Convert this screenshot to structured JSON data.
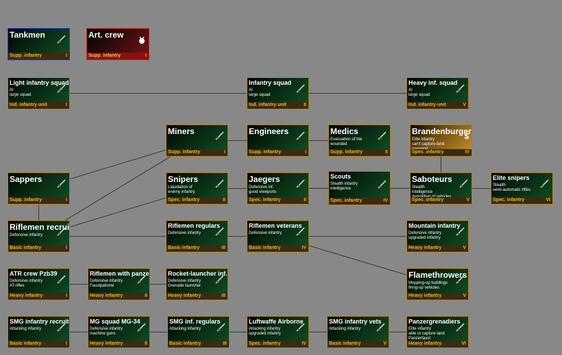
{
  "nodes": [
    {
      "id": "tankmen",
      "name": "Tankmen",
      "desc": "",
      "cls": "Supp. infantry",
      "tier": "I",
      "style": "blue",
      "big": true,
      "icon": "rifle-icon"
    },
    {
      "id": "artcrew",
      "name": "Art. crew",
      "desc": "",
      "cls": "Supp. infantry",
      "tier": "I",
      "style": "red",
      "big": true,
      "icon": "medal-icon"
    },
    {
      "id": "light_inf",
      "name": "Light infantry squad",
      "desc": "AI\nlarge squad",
      "cls": "Ind. infantry unit",
      "tier": "I",
      "big": false,
      "icon": "rifle-icon"
    },
    {
      "id": "inf_squad",
      "name": "Infantry squad",
      "desc": "AI\nlarge squad",
      "cls": "Ind. infantry unit",
      "tier": "II",
      "big": false,
      "icon": "rifle-icon"
    },
    {
      "id": "heavy_squad",
      "name": "Heavy inf. squad",
      "desc": "AI\nlarge squad",
      "cls": "Ind. infantry unit",
      "tier": "V",
      "big": false,
      "icon": "rifle-icon"
    },
    {
      "id": "miners",
      "name": "Miners",
      "desc": "",
      "cls": "Supp. infantry",
      "tier": "I",
      "big": true,
      "icon": "rifle-icon"
    },
    {
      "id": "engineers",
      "name": "Engineers",
      "desc": "",
      "cls": "Supp. infantry",
      "tier": "I",
      "big": true,
      "icon": "rifle-icon"
    },
    {
      "id": "medics",
      "name": "Medics",
      "desc": "Evacuation of the\nwounded",
      "cls": "Supp. infantry",
      "tier": "II",
      "big": true,
      "icon": "rifle-icon"
    },
    {
      "id": "brandenburgers",
      "name": "Brandenburgers",
      "desc": "Elite infantry\ncan't capture land\ntransport",
      "cls": "Spec. infantry",
      "tier": "IV",
      "style": "gold",
      "big": true,
      "icon": "dollar-icon"
    },
    {
      "id": "sappers",
      "name": "Sappers",
      "desc": "",
      "cls": "Supp. infantry",
      "tier": "I",
      "big": true,
      "icon": "rifle-icon"
    },
    {
      "id": "snipers",
      "name": "Snipers",
      "desc": "Liquidation of\nenemy infantry",
      "cls": "Spec. infantry",
      "tier": "II",
      "big": true,
      "icon": "rifle-icon"
    },
    {
      "id": "jaegers",
      "name": "Jaegers",
      "desc": "Defensive inf.\ngood viewports",
      "cls": "Spec. infantry",
      "tier": "II",
      "big": true,
      "icon": "rifle-icon"
    },
    {
      "id": "scouts",
      "name": "Scouts",
      "desc": "Stealth infantry\nintelligence",
      "cls": "Spec. infantry",
      "tier": "IV",
      "big": false,
      "icon": "rifle-icon"
    },
    {
      "id": "saboteurs",
      "name": "Saboteurs",
      "desc": "Stealth\nintelligence\ndemolition of vehicles",
      "cls": "Spec. infantry",
      "tier": "V",
      "big": true,
      "icon": "rifle-icon"
    },
    {
      "id": "elite_snipers",
      "name": "Elite snipers",
      "desc": "Stealth\nsemi-automatic rifles",
      "cls": "Spec. infantry",
      "tier": "VI",
      "big": false,
      "icon": "rifle-icon"
    },
    {
      "id": "rifle_recruits",
      "name": "Riflemen recruits",
      "desc": "Defensive infantry",
      "cls": "Basic infantry",
      "tier": "I",
      "big": true,
      "icon": "rifle-icon"
    },
    {
      "id": "rifle_regulars",
      "name": "Riflemen regulars",
      "desc": "Defensive infantry",
      "cls": "Basic infantry",
      "tier": "III",
      "big": false,
      "icon": "rifle-icon"
    },
    {
      "id": "rifle_veterans",
      "name": "Riflemen veterans",
      "desc": "Defensive infantry",
      "cls": "Basic infantry",
      "tier": "IV",
      "big": false,
      "icon": "rifle-icon"
    },
    {
      "id": "mountain",
      "name": "Mountain infantry",
      "desc": "Defensive infantry\nupgraded infantry",
      "cls": "Heavy infantry",
      "tier": "V",
      "big": false,
      "icon": "rifle-icon"
    },
    {
      "id": "atr_crew",
      "name": "ATR crew Pzb39",
      "desc": "Defensive infantry\nAT-rifles",
      "cls": "Heavy infantry",
      "tier": "I",
      "big": false,
      "icon": "rifle-icon"
    },
    {
      "id": "rifle_pf",
      "name": "Riflemen with panzerfaust",
      "desc": "Defensive infantry\nFaustpatrone",
      "cls": "Heavy infantry",
      "tier": "II",
      "big": false,
      "icon": "rifle-icon"
    },
    {
      "id": "rocket",
      "name": "Rocket-launcher inf.",
      "desc": "Defensive infantry\nGrenade launcher",
      "cls": "Heavy infantry",
      "tier": "III",
      "big": false,
      "icon": "rifle-icon"
    },
    {
      "id": "flamethrowers",
      "name": "Flamethrowers",
      "desc": "Mopping-up buildings\nfiring-up vehicles",
      "cls": "Heavy infantry",
      "tier": "V",
      "big": true,
      "icon": "rifle-icon"
    },
    {
      "id": "smg_recruits",
      "name": "SMG infantry recruits",
      "desc": "Attacking infantry",
      "cls": "Basic infantry",
      "tier": "I",
      "big": false,
      "icon": "rifle-icon"
    },
    {
      "id": "mg_squad",
      "name": "MG squad MG-34",
      "desc": "Defensive infantry\nmachine guns",
      "cls": "Heavy infantry",
      "tier": "II",
      "big": false,
      "icon": "rifle-icon"
    },
    {
      "id": "smg_regulars",
      "name": "SMG inf. regulars",
      "desc": "Attacking infantry",
      "cls": "Basic infantry",
      "tier": "III",
      "big": false,
      "icon": "rifle-icon"
    },
    {
      "id": "luftwaffe",
      "name": "Luftwaffe Airborne",
      "desc": "Attacking infantry\nupgraded infantry",
      "cls": "Spec. infantry",
      "tier": "IV",
      "big": false,
      "icon": "rifle-icon"
    },
    {
      "id": "smg_vets",
      "name": "SMG infantry vets",
      "desc": "Attacking infantry",
      "cls": "Basic infantry",
      "tier": "V",
      "big": false,
      "icon": "rifle-icon"
    },
    {
      "id": "panzergren",
      "name": "Panzergrenadiers",
      "desc": "Elite infantry\nable to capture land\nPanzerfaust",
      "cls": "Heavy infantry",
      "tier": "VI",
      "big": false,
      "icon": "rifle-icon"
    }
  ],
  "links": [
    [
      "light_inf",
      "inf_squad"
    ],
    [
      "inf_squad",
      "heavy_squad"
    ],
    [
      "miners",
      "engineers"
    ],
    [
      "engineers",
      "medics"
    ],
    [
      "sappers",
      "miners"
    ],
    [
      "rifle_recruits",
      "miners"
    ],
    [
      "rifle_recruits",
      "snipers"
    ],
    [
      "sappers",
      "rifle_recruits"
    ],
    [
      "snipers",
      "jaegers"
    ],
    [
      "jaegers",
      "scouts"
    ],
    [
      "scouts",
      "saboteurs"
    ],
    [
      "saboteurs",
      "elite_snipers"
    ],
    [
      "brandenburgers",
      "saboteurs"
    ],
    [
      "rifle_recruits",
      "rifle_regulars"
    ],
    [
      "rifle_regulars",
      "rifle_veterans"
    ],
    [
      "rifle_veterans",
      "mountain"
    ],
    [
      "rifle_veterans",
      "flamethrowers"
    ],
    [
      "atr_crew",
      "rifle_pf"
    ],
    [
      "rifle_pf",
      "rocket"
    ],
    [
      "smg_recruits",
      "mg_squad"
    ],
    [
      "mg_squad",
      "smg_regulars"
    ],
    [
      "smg_regulars",
      "luftwaffe"
    ],
    [
      "luftwaffe",
      "smg_vets"
    ],
    [
      "smg_vets",
      "panzergren"
    ]
  ]
}
